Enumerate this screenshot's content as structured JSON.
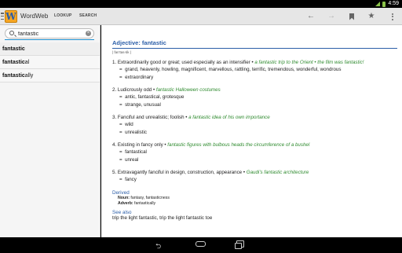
{
  "status": {
    "time": "4:59"
  },
  "app": {
    "title": "WordWeb",
    "icon_letter": "W"
  },
  "tabs": [
    {
      "label": "LOOKUP"
    },
    {
      "label": "SEARCH"
    }
  ],
  "search": {
    "value": "fantastic",
    "placeholder": ""
  },
  "results": [
    {
      "bold": "fantastic",
      "rest": ""
    },
    {
      "bold": "fantastic",
      "rest": "al"
    },
    {
      "bold": "fantastic",
      "rest": "ally"
    }
  ],
  "entry": {
    "heading": "Adjective: fantastic",
    "pronunciation": "| fan'tas-tik |",
    "senses": [
      {
        "num": "1.",
        "def": "Extraordinarily good or great; used especially as an intensifier",
        "bullet": " • ",
        "examples": "a fantastic trip to the Orient • the film was fantastic!",
        "similar": "grand, heavenly, howling, magnificent, marvellous, rattling, terrific, tremendous, wonderful, wondrous",
        "similar2": "extraordinary"
      },
      {
        "num": "2.",
        "def": "Ludicrously odd",
        "bullet": " • ",
        "examples": "fantastic Halloween costumes",
        "similar": "antic, fantastical, grotesque",
        "similar2": "strange, unusual"
      },
      {
        "num": "3.",
        "def": "Fanciful and unrealistic; foolish",
        "bullet": " • ",
        "examples": "a fantastic idea of his own importance",
        "similar": "wild",
        "similar2": "unrealistic"
      },
      {
        "num": "4.",
        "def": "Existing in fancy only",
        "bullet": " • ",
        "examples": "fantastic figures with bulbous heads the circumference of a bushel",
        "similar": "fantastical",
        "similar2": "unreal"
      },
      {
        "num": "5.",
        "def": "Extravagantly fanciful in design, construction, appearance",
        "bullet": " • ",
        "examples": "Gaudi's fantastic architecture",
        "similar": "fancy",
        "similar2": ""
      }
    ],
    "eq_symbol": "=",
    "derived_heading": "Derived",
    "derived": [
      {
        "pos": "Noun:",
        "words": " fantasy, fantasticness"
      },
      {
        "pos": "Adverb:",
        "words": " fantastically"
      }
    ],
    "see_also_heading": "See also",
    "see_also": "trip the light fantastic, trip the light fantastic toe"
  },
  "icons": {
    "back": "←",
    "forward": "→",
    "star": "★",
    "nav_back": "⮌"
  },
  "colors": {
    "accent": "#1e8fd0",
    "heading": "#2b5ea8",
    "example": "#2f8b2f",
    "app_icon": "#f6a623"
  }
}
